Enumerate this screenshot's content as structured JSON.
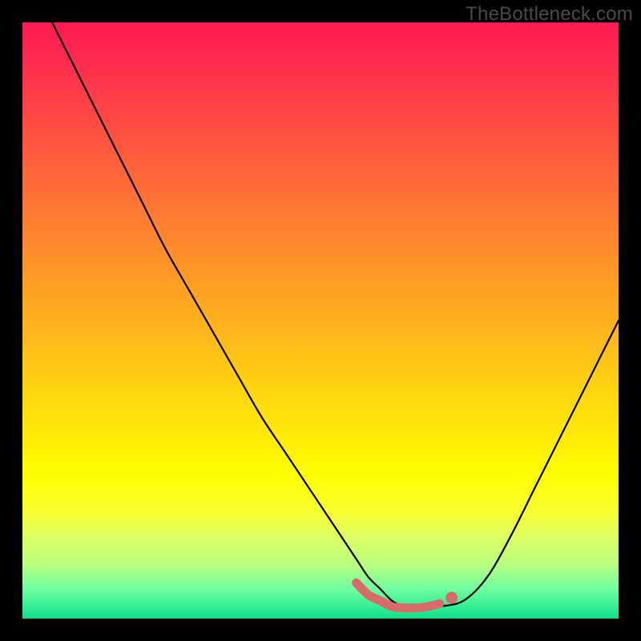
{
  "watermark": {
    "text": "TheBottleneck.com"
  },
  "colors": {
    "page_bg": "#000000",
    "curve": "#000000",
    "segment": "#d86a6a",
    "marker": "#d86a6a"
  },
  "chart_data": {
    "type": "line",
    "title": "",
    "xlabel": "",
    "ylabel": "",
    "xlim": [
      0,
      100
    ],
    "ylim": [
      0,
      100
    ],
    "grid": false,
    "legend": false,
    "series": [
      {
        "name": "bottleneck-curve",
        "x": [
          5,
          8,
          12,
          16,
          20,
          24,
          28,
          32,
          36,
          40,
          44,
          48,
          52,
          56,
          58,
          60,
          62,
          64,
          66,
          68,
          70,
          74,
          78,
          82,
          86,
          90,
          94,
          98,
          100
        ],
        "y": [
          100,
          94,
          86,
          78,
          70,
          62,
          55,
          48,
          41,
          34,
          28,
          22,
          16,
          10,
          7,
          5,
          3,
          2,
          1.5,
          1.5,
          2,
          3,
          7,
          14,
          22,
          30,
          38,
          46,
          50
        ]
      },
      {
        "name": "good-fit-segment",
        "x": [
          56,
          58,
          60,
          62,
          64,
          66,
          68,
          70
        ],
        "y": [
          6,
          4,
          3,
          2,
          1.8,
          1.8,
          2,
          2.5
        ]
      }
    ],
    "markers": [
      {
        "name": "current-point",
        "x": 72,
        "y": 3.5
      }
    ]
  }
}
